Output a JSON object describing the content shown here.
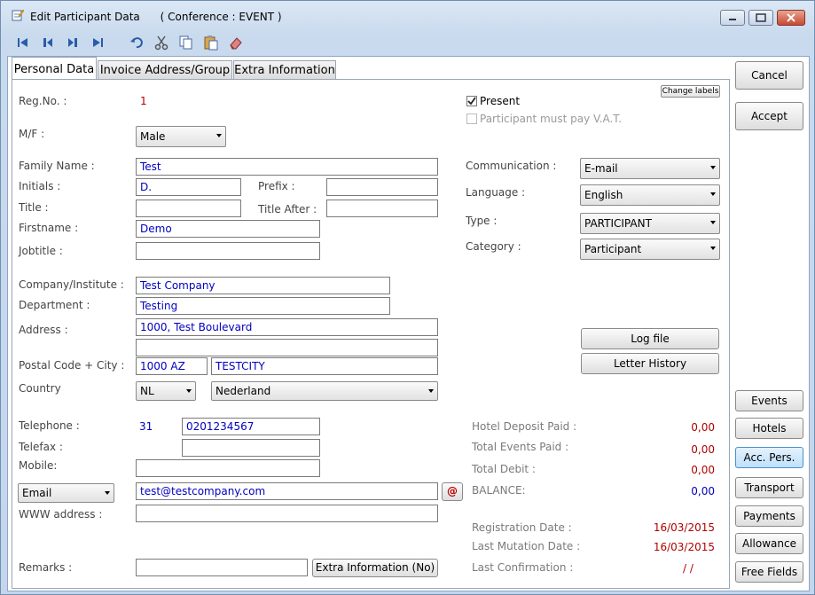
{
  "window": {
    "title": "Edit Participant Data",
    "subtitle": "( Conference : EVENT )"
  },
  "toolbar": {
    "icons": [
      "first-record-icon",
      "prev-record-icon",
      "next-record-icon",
      "last-record-icon",
      "undo-icon",
      "cut-icon",
      "copy-icon",
      "paste-icon",
      "eraser-icon"
    ]
  },
  "tabs": [
    "Personal Data",
    "Invoice Address/Group",
    "Extra Information"
  ],
  "personal": {
    "regno_label": "Reg.No. :",
    "regno_value": "1",
    "present_label": "Present",
    "present_checked": true,
    "vat_label": "Participant must pay V.A.T.",
    "vat_checked": false,
    "change_labels": "Change labels",
    "mf_label": "M/F :",
    "mf_value": "Male",
    "family_label": "Family Name :",
    "family_value": "Test",
    "initials_label": "Initials :",
    "initials_value": "D.",
    "prefix_label": "Prefix :",
    "prefix_value": "",
    "title_label": "Title :",
    "title_value": "",
    "title_after_label": "Title After :",
    "title_after_value": "",
    "firstname_label": "Firstname :",
    "firstname_value": "Demo",
    "jobtitle_label": "Jobtitle :",
    "jobtitle_value": "",
    "company_label": "Company/Institute :",
    "company_value": "Test Company",
    "department_label": "Department :",
    "department_value": "Testing",
    "address_label": "Address :",
    "address_value": "1000, Test Boulevard",
    "address2_value": "",
    "postal_label": "Postal Code + City :",
    "postal_value": "1000 AZ",
    "city_value": "TESTCITY",
    "country_label": "Country",
    "country_code": "NL",
    "country_name": "Nederland",
    "telephone_label": "Telephone :",
    "telephone_prefix": "31",
    "telephone_value": "0201234567",
    "telefax_label": "Telefax :",
    "telefax_value": "",
    "mobile_label": "Mobile:",
    "mobile_value": "",
    "email_type": "Email",
    "email_value": "test@testcompany.com",
    "email_button": "@",
    "www_label": "WWW address :",
    "www_value": "",
    "remarks_label": "Remarks :",
    "remarks_value": "",
    "extra_info_button": "Extra Information (No)",
    "communication_label": "Communication :",
    "communication_value": "E-mail",
    "language_label": "Language :",
    "language_value": "English",
    "type_label": "Type :",
    "type_value": "PARTICIPANT",
    "category_label": "Category :",
    "category_value": "Participant",
    "logfile_button": "Log file",
    "letter_history_button": "Letter History",
    "hotel_deposit_label": "Hotel Deposit Paid :",
    "hotel_deposit_value": "0,00",
    "total_events_label": "Total Events Paid :",
    "total_events_value": "0,00",
    "total_debit_label": "Total Debit :",
    "total_debit_value": "0,00",
    "balance_label": "BALANCE:",
    "balance_value": "0,00",
    "reg_date_label": "Registration Date :",
    "reg_date_value": "16/03/2015",
    "last_mut_label": "Last Mutation Date :",
    "last_mut_value": "16/03/2015",
    "last_conf_label": "Last Confirmation :",
    "last_conf_value": "/ /"
  },
  "side_buttons": {
    "cancel": "Cancel",
    "accept": "Accept",
    "events": "Events",
    "hotels": "Hotels",
    "acc_pers": "Acc. Pers.",
    "transport": "Transport",
    "payments": "Payments",
    "allowance": "Allowance",
    "free_fields": "Free Fields"
  },
  "colors": {
    "value_red": "#b00000",
    "value_blue": "#0000c0",
    "window_blue": "#c4d6ec"
  }
}
